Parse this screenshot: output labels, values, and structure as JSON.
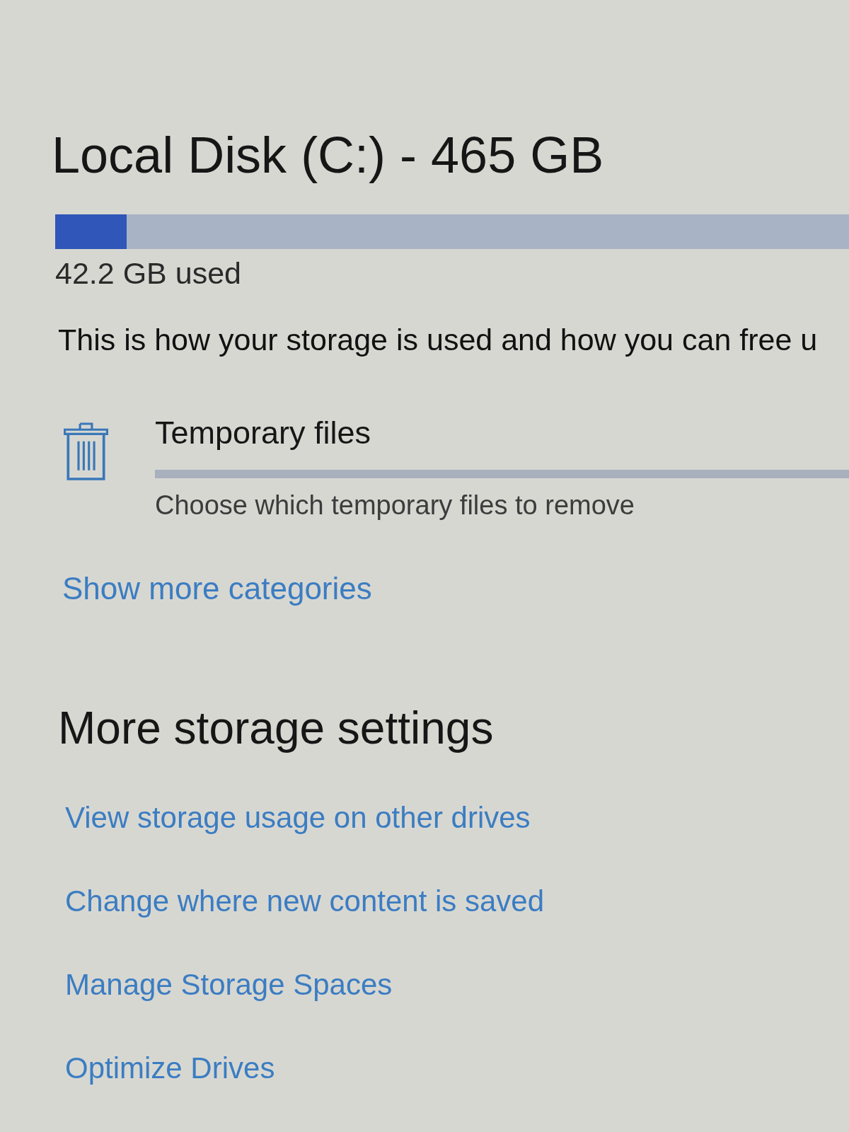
{
  "header": {
    "title": "Local Disk (C:) - 465 GB",
    "usage": {
      "level": 0.09
    },
    "used_label": "42.2 GB used"
  },
  "description": "This is how your storage is used and how you can free u",
  "categories": [
    {
      "kind": "trash",
      "name": "Temporary files",
      "subtitle": "Choose which temporary files to remove"
    }
  ],
  "show_more_link": "Show more categories",
  "more_settings": {
    "heading": "More storage settings",
    "links": [
      "View storage usage on other drives",
      "Change where new content is saved",
      "Manage Storage Spaces",
      "Optimize Drives"
    ]
  }
}
